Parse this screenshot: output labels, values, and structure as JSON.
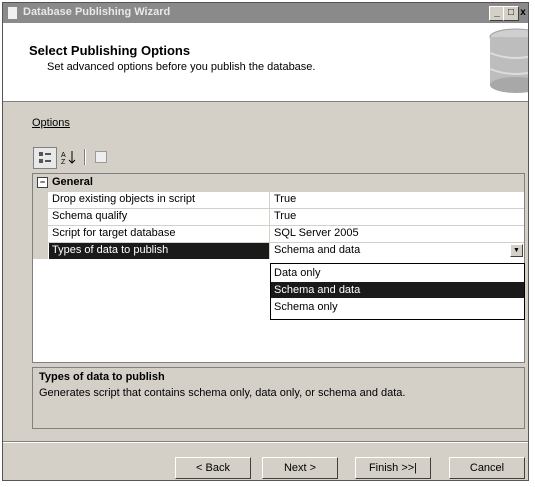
{
  "window": {
    "title": "Database Publishing Wizard",
    "controls": {
      "minimize": "_",
      "maximize": "□",
      "close": "x"
    }
  },
  "header": {
    "title": "Select Publishing Options",
    "subtitle": "Set advanced options before you publish the database."
  },
  "options_label": "Options",
  "toolbar": {
    "categorized_icon": "categorized-icon",
    "alphabetical_icon": "sort-alphabetical-icon",
    "property_pages_icon": "property-pages-icon"
  },
  "grid": {
    "category": {
      "toggle": "⊟",
      "label": "General"
    },
    "rows": [
      {
        "name": "Drop existing objects in script",
        "value": "True"
      },
      {
        "name": "Schema qualify",
        "value": "True"
      },
      {
        "name": "Script for target database",
        "value": "SQL Server 2005"
      },
      {
        "name": "Types of data to publish",
        "value": "Schema and data"
      }
    ],
    "selected_row": 3,
    "dropdown_options": [
      "Data only",
      "Schema and data",
      "Schema only"
    ],
    "dropdown_selected": 1
  },
  "description": {
    "title": "Types of data to publish",
    "text": "Generates script that contains schema only, data only, or schema and data."
  },
  "buttons": {
    "back": "< Back",
    "next": "Next >",
    "finish": "Finish >>|",
    "cancel": "Cancel"
  }
}
